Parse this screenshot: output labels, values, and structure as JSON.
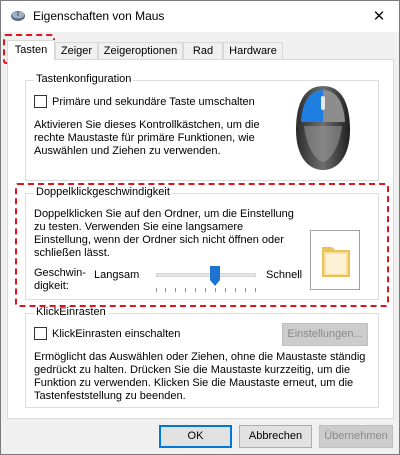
{
  "window": {
    "title": "Eigenschaften von Maus"
  },
  "tabs": [
    {
      "label": "Tasten"
    },
    {
      "label": "Zeiger"
    },
    {
      "label": "Zeigeroptionen"
    },
    {
      "label": "Rad"
    },
    {
      "label": "Hardware"
    }
  ],
  "button_config": {
    "group_label": "Tastenkonfiguration",
    "swap_label": "Primäre und sekundäre Taste umschalten",
    "swap_checked": false,
    "desc_lines": [
      "Aktivieren Sie dieses Kontrollkästchen, um die",
      "rechte Maustaste für primäre Funktionen, wie",
      "Auswählen und Ziehen zu verwenden."
    ]
  },
  "double_click": {
    "group_label": "Doppelklickgeschwindigkeit",
    "desc_lines": [
      "Doppelklicken Sie auf den Ordner, um die Einstellung",
      "zu testen. Verwenden Sie eine langsamere",
      "Einstellung, wenn der Ordner sich nicht öffnen oder",
      "schließen lässt."
    ],
    "speed_label_lines": [
      "Geschwin-",
      "digkeit:"
    ],
    "slow_label": "Langsam",
    "fast_label": "Schnell",
    "speed_fraction": 0.6
  },
  "click_lock": {
    "group_label": "KlickEinrasten",
    "enable_label": "KlickEinrasten einschalten",
    "enable_checked": false,
    "settings_button": "Einstellungen...",
    "desc_lines": [
      "Ermöglicht das Auswählen oder Ziehen, ohne die Maustaste ständig",
      "gedrückt zu halten. Drücken Sie die Maustaste kurzzeitig, um die",
      "Funktion zu verwenden. Klicken Sie die Maustaste erneut, um die",
      "Tastenfeststellung zu beenden."
    ]
  },
  "footer": {
    "ok": "OK",
    "cancel": "Abbrechen",
    "apply": "Übernehmen"
  },
  "colors": {
    "highlight": "#e0141e",
    "accent": "#0078d7"
  }
}
